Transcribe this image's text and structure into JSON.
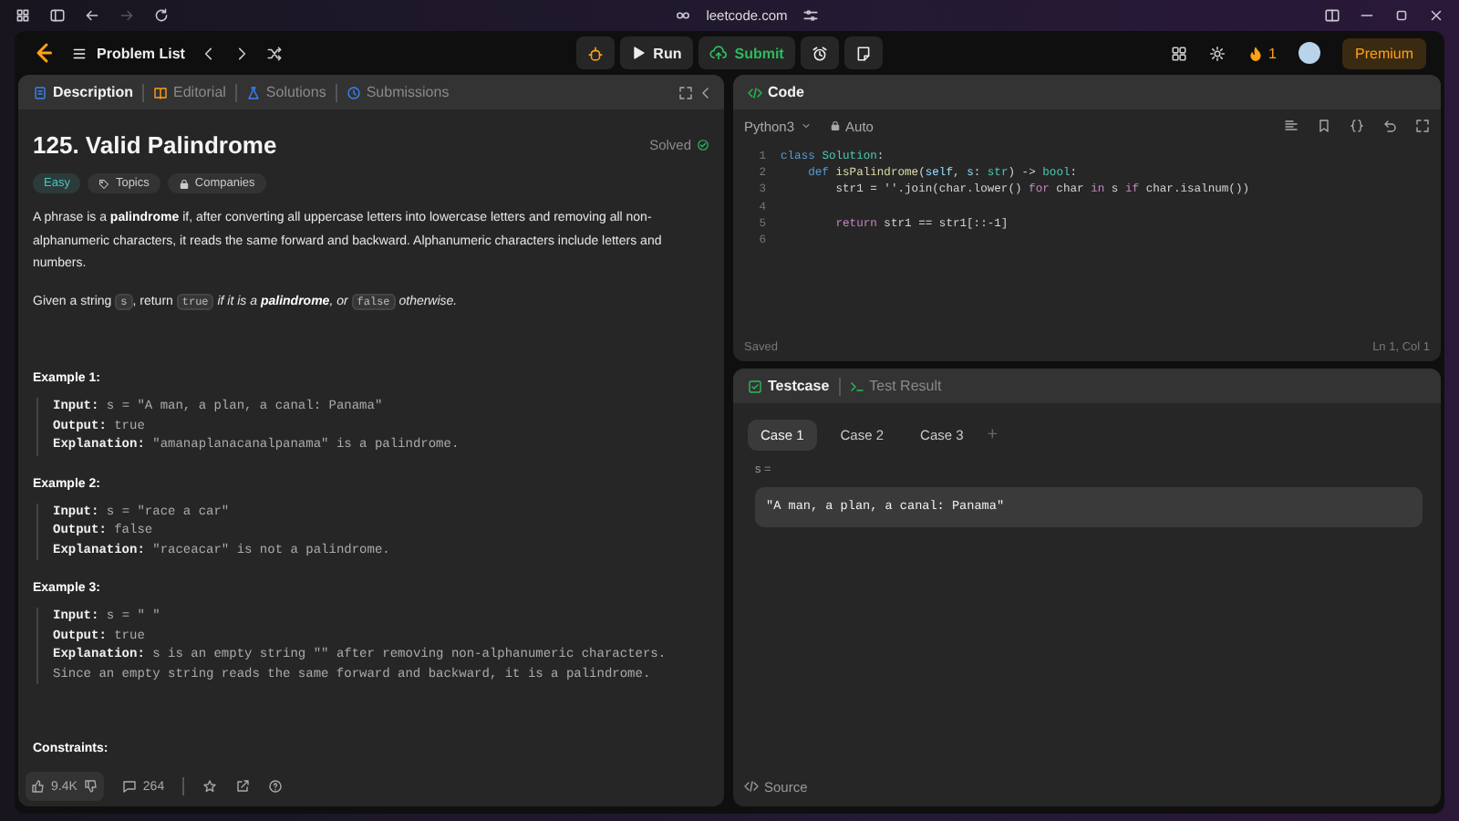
{
  "browser": {
    "address": "leetcode.com"
  },
  "header": {
    "problem_list": "Problem List",
    "run": "Run",
    "submit": "Submit",
    "streak": "1",
    "premium": "Premium"
  },
  "description_panel": {
    "tabs": [
      {
        "label": "Description",
        "kind": "description",
        "selected": true
      },
      {
        "label": "Editorial",
        "kind": "editorial",
        "selected": false
      },
      {
        "label": "Solutions",
        "kind": "solutions",
        "selected": false
      },
      {
        "label": "Submissions",
        "kind": "submissions",
        "selected": false
      }
    ],
    "title": "125. Valid Palindrome",
    "status": "Solved",
    "tags": [
      {
        "label": "Easy",
        "kind": "difficulty"
      },
      {
        "label": "Topics",
        "kind": "topics"
      },
      {
        "label": "Companies",
        "kind": "companies"
      }
    ],
    "paragraphs": [
      [
        {
          "kind": "text",
          "text": "A phrase is a **palindrome** if, after converting all uppercase letters into lowercase letters and removing all non-alphanumeric characters, it reads the same forward and backward. Alphanumeric characters include letters and numbers."
        }
      ],
      [
        {
          "kind": "text",
          "text": "Given a string "
        },
        {
          "kind": "code",
          "text": "s"
        },
        {
          "kind": "text",
          "text": ", return "
        },
        {
          "kind": "code",
          "text": "true"
        },
        {
          "kind": "em",
          "text": " if it is a **palindrome**, or "
        },
        {
          "kind": "code",
          "text": "false"
        },
        {
          "kind": "em",
          "text": " otherwise."
        }
      ]
    ],
    "examples": [
      {
        "title": "Example 1:",
        "lines": [
          {
            "label": "Input:",
            "value": "s = \"A man, a plan, a canal: Panama\""
          },
          {
            "label": "Output:",
            "value": "true"
          },
          {
            "label": "Explanation:",
            "value": "\"amanaplanacanalpanama\" is a palindrome."
          }
        ]
      },
      {
        "title": "Example 2:",
        "lines": [
          {
            "label": "Input:",
            "value": "s = \"race a car\""
          },
          {
            "label": "Output:",
            "value": "false"
          },
          {
            "label": "Explanation:",
            "value": "\"raceacar\" is not a palindrome."
          }
        ]
      },
      {
        "title": "Example 3:",
        "lines": [
          {
            "label": "Input:",
            "value": "s = \" \""
          },
          {
            "label": "Output:",
            "value": "true"
          },
          {
            "label": "Explanation:",
            "value": "s is an empty string \"\" after removing non-alphanumeric characters. Since an empty string reads the same forward and backward, it is a palindrome."
          }
        ]
      }
    ],
    "constraints_heading": "Constraints:",
    "footer": {
      "likes": "9.4K",
      "comments": "264"
    }
  },
  "code_panel": {
    "title": "Code",
    "language": "Python3",
    "mode": "Auto",
    "lines": [
      {
        "number": "1",
        "tokens": [
          {
            "kind": "keyword",
            "text": "class "
          },
          {
            "kind": "type",
            "text": "Solution"
          },
          {
            "kind": "plain",
            "text": ":"
          }
        ]
      },
      {
        "number": "2",
        "tokens": [
          {
            "kind": "keyword",
            "text": "    def "
          },
          {
            "kind": "function",
            "text": "isPalindrome"
          },
          {
            "kind": "plain",
            "text": "("
          },
          {
            "kind": "param",
            "text": "self"
          },
          {
            "kind": "plain",
            "text": ", "
          },
          {
            "kind": "param",
            "text": "s"
          },
          {
            "kind": "plain",
            "text": ": "
          },
          {
            "kind": "type",
            "text": "str"
          },
          {
            "kind": "plain",
            "text": ") -> "
          },
          {
            "kind": "type",
            "text": "bool"
          },
          {
            "kind": "plain",
            "text": ":"
          }
        ]
      },
      {
        "number": "3",
        "tokens": [
          {
            "kind": "plain",
            "text": "        str1 = ''.join(char.lower() "
          },
          {
            "kind": "control",
            "text": "for"
          },
          {
            "kind": "plain",
            "text": " char "
          },
          {
            "kind": "control",
            "text": "in"
          },
          {
            "kind": "plain",
            "text": " s "
          },
          {
            "kind": "control",
            "text": "if"
          },
          {
            "kind": "plain",
            "text": " char.isalnum())"
          }
        ]
      },
      {
        "number": "4"
      },
      {
        "number": "5",
        "tokens": [
          {
            "kind": "control",
            "text": "        return"
          },
          {
            "kind": "plain",
            "text": " str1 == str1[::-1]"
          }
        ]
      },
      {
        "number": "6"
      }
    ],
    "status": "Saved",
    "cursor": "Ln 1, Col 1"
  },
  "testcase_panel": {
    "tabs": [
      {
        "label": "Testcase",
        "kind": "testcase",
        "selected": true
      },
      {
        "label": "Test Result",
        "kind": "result",
        "selected": false
      }
    ],
    "cases": [
      {
        "label": "Case 1",
        "selected": true
      },
      {
        "label": "Case 2",
        "selected": false
      },
      {
        "label": "Case 3",
        "selected": false
      }
    ],
    "add": "+",
    "param": "s =",
    "value": "\"A man, a plan, a canal: Panama\"",
    "source": "Source"
  }
}
